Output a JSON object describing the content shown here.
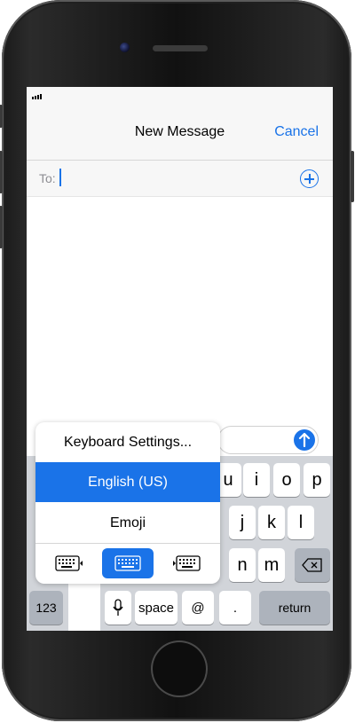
{
  "navbar": {
    "title": "New Message",
    "cancel_label": "Cancel"
  },
  "recipient": {
    "label": "To:",
    "value": ""
  },
  "keyboard_menu": {
    "items": [
      "Keyboard Settings...",
      "English (US)",
      "Emoji"
    ],
    "selected": "English (US)",
    "layout_options": [
      "left-handed-keyboard-icon",
      "full-keyboard-icon",
      "right-handed-keyboard-icon"
    ],
    "selected_layout": "full-keyboard-icon"
  },
  "keys": {
    "row1": [
      "u",
      "i",
      "o",
      "p"
    ],
    "row2": [
      "j",
      "k",
      "l"
    ],
    "row3": [
      "n",
      "m"
    ],
    "numbers_label": "123",
    "space_label": "space",
    "at_label": "@",
    "dot_label": ".",
    "return_label": "return"
  },
  "colors": {
    "accent": "#1a73e8",
    "keyboard_bg": "#d1d4d9",
    "special_key": "#adb3bc"
  }
}
